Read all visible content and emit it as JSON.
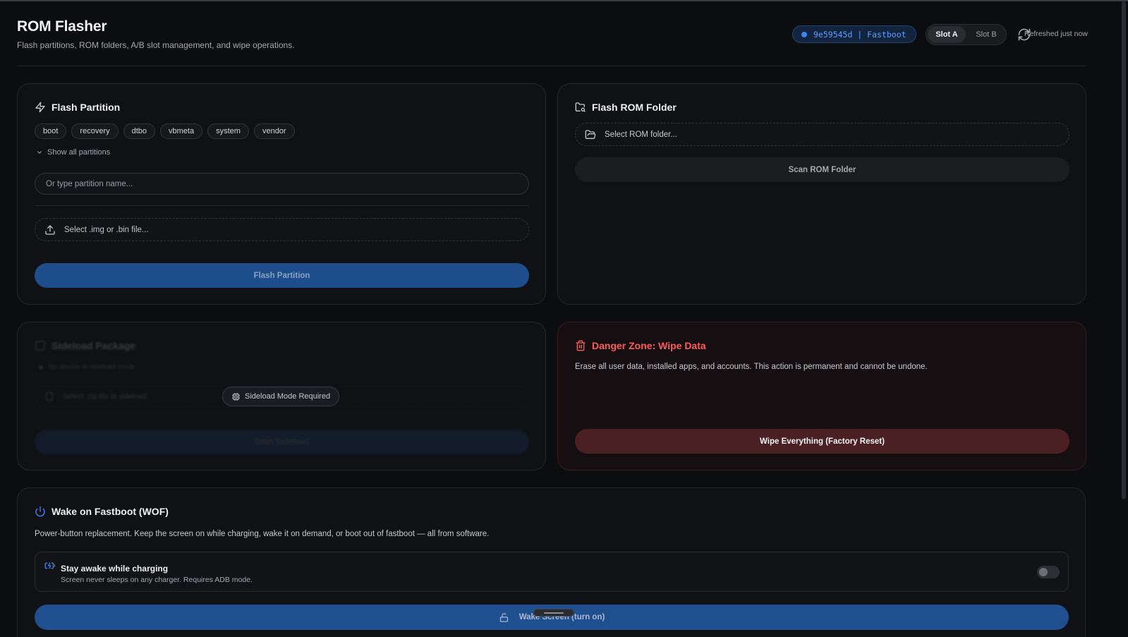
{
  "header": {
    "title": "ROM Flasher",
    "subtitle": "Flash partitions, ROM folders, A/B slot management, and wipe operations.",
    "device": "9e59545d | Fastboot",
    "slots": [
      "Slot A",
      "Slot B"
    ],
    "active_slot": "Slot A",
    "refresh_status": "Refreshed just now"
  },
  "flash_partition": {
    "title": "Flash Partition",
    "chips": [
      "boot",
      "recovery",
      "dtbo",
      "vbmeta",
      "system",
      "vendor"
    ],
    "show_all": "Show all partitions",
    "partition_placeholder": "Or type partition name...",
    "file_picker": "Select .img or .bin file...",
    "button": "Flash Partition"
  },
  "rom_folder": {
    "title": "Flash ROM Folder",
    "folder_picker": "Select ROM folder...",
    "button": "Scan ROM Folder"
  },
  "sideload": {
    "title": "Sideload Package",
    "status_line": "No device in sideload mode",
    "file_picker": "Select .zip file to sideload",
    "button": "Start Sideload",
    "overlay": "Sideload Mode Required"
  },
  "danger": {
    "title": "Danger Zone: Wipe Data",
    "description": "Erase all user data, installed apps, and accounts. This action is permanent and cannot be undone.",
    "button": "Wipe Everything (Factory Reset)"
  },
  "wof": {
    "title": "Wake on Fastboot (WOF)",
    "description": "Power-button replacement. Keep the screen on while charging, wake it on demand, or boot out of fastboot — all from software.",
    "stay_awake_title": "Stay awake while charging",
    "stay_awake_sub": "Screen never sleeps on any charger. Requires ADB mode.",
    "stay_awake_enabled": false,
    "wake_button": "Wake Screen (turn on)"
  },
  "colors": {
    "accent": "#1e4d8c",
    "danger": "#ff5a5a",
    "device": "#5aa0ff"
  }
}
